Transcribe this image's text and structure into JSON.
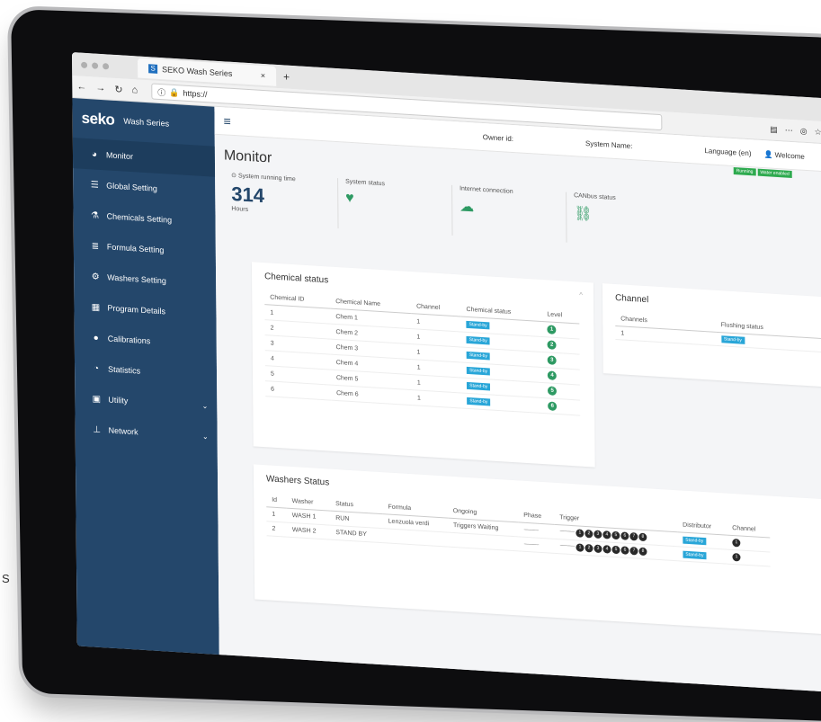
{
  "edge_label": "S",
  "browser": {
    "tab_title": "SEKO Wash Series",
    "tab_close": "×",
    "new_tab": "+",
    "url": "https://"
  },
  "sidebar": {
    "logo": "seko",
    "subtitle": "Wash Series",
    "items": [
      {
        "label": "Monitor",
        "icon": "dashboard-icon"
      },
      {
        "label": "Global Setting",
        "icon": "sliders-icon"
      },
      {
        "label": "Chemicals Setting",
        "icon": "flask-icon"
      },
      {
        "label": "Formula Setting",
        "icon": "list-icon"
      },
      {
        "label": "Washers Setting",
        "icon": "gears-icon"
      },
      {
        "label": "Program Details",
        "icon": "details-icon"
      },
      {
        "label": "Calibrations",
        "icon": "drop-icon"
      },
      {
        "label": "Statistics",
        "icon": "pie-icon"
      },
      {
        "label": "Utility",
        "icon": "toolbox-icon"
      },
      {
        "label": "Network",
        "icon": "network-icon"
      }
    ]
  },
  "topbar": {
    "owner": "Owner id:",
    "system_name": "System Name:",
    "language": "Language (en)",
    "welcome": "Welcome"
  },
  "badges": {
    "running": "Running",
    "water": "Water enabled"
  },
  "page_title": "Monitor",
  "status": {
    "running_time_label": "System running time",
    "running_time_value": "314",
    "running_time_unit": "Hours",
    "system_status_label": "System status",
    "internet_label": "Internet connection",
    "canbus_label": "CANbus status"
  },
  "chemical_status": {
    "title": "Chemical status",
    "headers": [
      "Chemical ID",
      "Chemical Name",
      "Channel",
      "Chemical status",
      "Level"
    ],
    "rows": [
      {
        "id": "1",
        "name": "Chem 1",
        "channel": "1",
        "status": "Stand-by",
        "level": "1"
      },
      {
        "id": "2",
        "name": "Chem 2",
        "channel": "1",
        "status": "Stand-by",
        "level": "2"
      },
      {
        "id": "3",
        "name": "Chem 3",
        "channel": "1",
        "status": "Stand-by",
        "level": "3"
      },
      {
        "id": "4",
        "name": "Chem 4",
        "channel": "1",
        "status": "Stand-by",
        "level": "4"
      },
      {
        "id": "5",
        "name": "Chem 5",
        "channel": "1",
        "status": "Stand-by",
        "level": "5"
      },
      {
        "id": "6",
        "name": "Chem 6",
        "channel": "1",
        "status": "Stand-by",
        "level": "6"
      }
    ]
  },
  "channel": {
    "title": "Channel",
    "headers": [
      "Channels",
      "Flushing status"
    ],
    "rows": [
      {
        "channel": "1",
        "status": "Stand-by"
      }
    ]
  },
  "washers": {
    "title": "Washers Status",
    "headers": [
      "Id",
      "Washer",
      "Status",
      "Formula",
      "Ongoing",
      "Phase",
      "Trigger",
      "Distributor",
      "Channel"
    ],
    "rows": [
      {
        "id": "1",
        "washer": "WASH 1",
        "status": "RUN",
        "formula": "Lenzuola verdi",
        "ongoing": "Triggers Waiting",
        "phase": "------------",
        "trigger": "------------",
        "triggers": [
          "1",
          "2",
          "3",
          "4",
          "5",
          "6",
          "7",
          "8"
        ],
        "distributor": "Stand-by",
        "channel": "1"
      },
      {
        "id": "2",
        "washer": "WASH 2",
        "status": "STAND BY",
        "formula": "",
        "ongoing": "",
        "phase": "------------",
        "trigger": "------------",
        "triggers": [
          "1",
          "2",
          "3",
          "4",
          "5",
          "6",
          "7",
          "8"
        ],
        "distributor": "Stand-by",
        "channel": "1"
      }
    ]
  }
}
